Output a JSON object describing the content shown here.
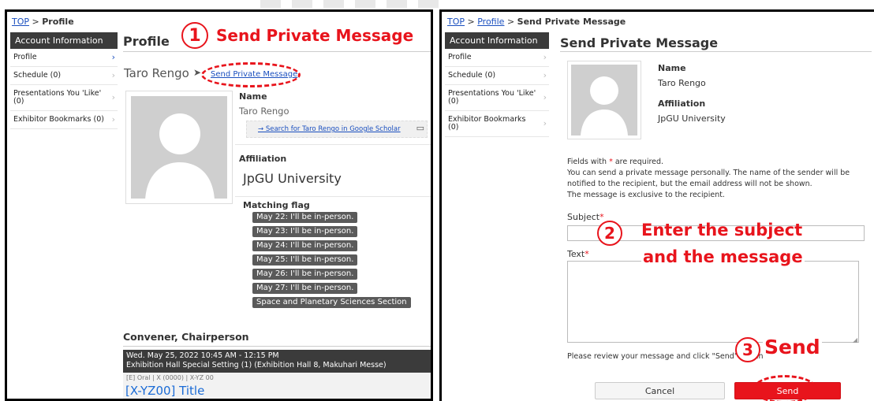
{
  "left": {
    "breadcrumb": {
      "top": "TOP",
      "sep": ">",
      "current": "Profile"
    },
    "sidebar": {
      "header": "Account Information",
      "items": [
        {
          "label": "Profile"
        },
        {
          "label": "Schedule (0)"
        },
        {
          "label": "Presentations You 'Like' (0)"
        },
        {
          "label": "Exhibitor Bookmarks (0)"
        }
      ]
    },
    "page_title": "Profile",
    "person_name_heading": "Taro Rengo",
    "send_link": "Send Private Message",
    "name_label": "Name",
    "name_value": "Taro Rengo",
    "scholar_link": "→ Search for Taro Rengo in Google Scholar",
    "affiliation_label": "Affiliation",
    "affiliation_value": "JpGU University",
    "matching_label": "Matching flag",
    "tags": [
      "May 22: I'll be in-person.",
      "May 23: I'll be in-person.",
      "May 24: I'll be in-person.",
      "May 25: I'll be in-person.",
      "May 26: I'll be in-person.",
      "May 27: I'll be in-person.",
      "Space and Planetary Sciences Section"
    ],
    "convener_heading": "Convener, Chairperson",
    "session_time": "Wed. May 25, 2022 10:45 AM - 12:15 PM",
    "session_place": "Exhibition Hall Special Setting (1) (Exhibition Hall 8, Makuhari Messe)",
    "session_meta": "[E] Oral | X (0000) | X-YZ 00",
    "session_title": "[X-YZ00] Title"
  },
  "right": {
    "breadcrumb": {
      "top": "TOP",
      "sep": ">",
      "profile": "Profile",
      "current": "Send Private Message"
    },
    "sidebar": {
      "header": "Account Information",
      "items": [
        {
          "label": "Profile"
        },
        {
          "label": "Schedule (0)"
        },
        {
          "label": "Presentations You 'Like' (0)"
        },
        {
          "label": "Exhibitor Bookmarks (0)"
        }
      ]
    },
    "page_title": "Send Private Message",
    "name_label": "Name",
    "name_value": "Taro Rengo",
    "affiliation_label": "Affiliation",
    "affiliation_value": "JpGU University",
    "required_note_a": "Fields with ",
    "required_star": "*",
    "required_note_b": " are required.",
    "info_line1": "You can send a private message personally. The name of the sender will be",
    "info_line2": "notified to the recipient, but the email address will not be shown.",
    "info_line3": "The message is exclusive to the recipient.",
    "subject_label": "Subject",
    "text_label": "Text",
    "review_note": "Please review your message and click \"Send\" to send it.",
    "cancel_label": "Cancel",
    "send_label": "Send"
  },
  "callouts": {
    "one_num": "1",
    "one_text": "Send Private Message",
    "two_num": "2",
    "two_line1": "Enter the subject",
    "two_line2": "and the message",
    "three_num": "3",
    "three_text": "Send"
  },
  "colors": {
    "accent_red": "#e8141c",
    "link_blue": "#1a4fbf",
    "dark_header": "#3b3b3b"
  }
}
